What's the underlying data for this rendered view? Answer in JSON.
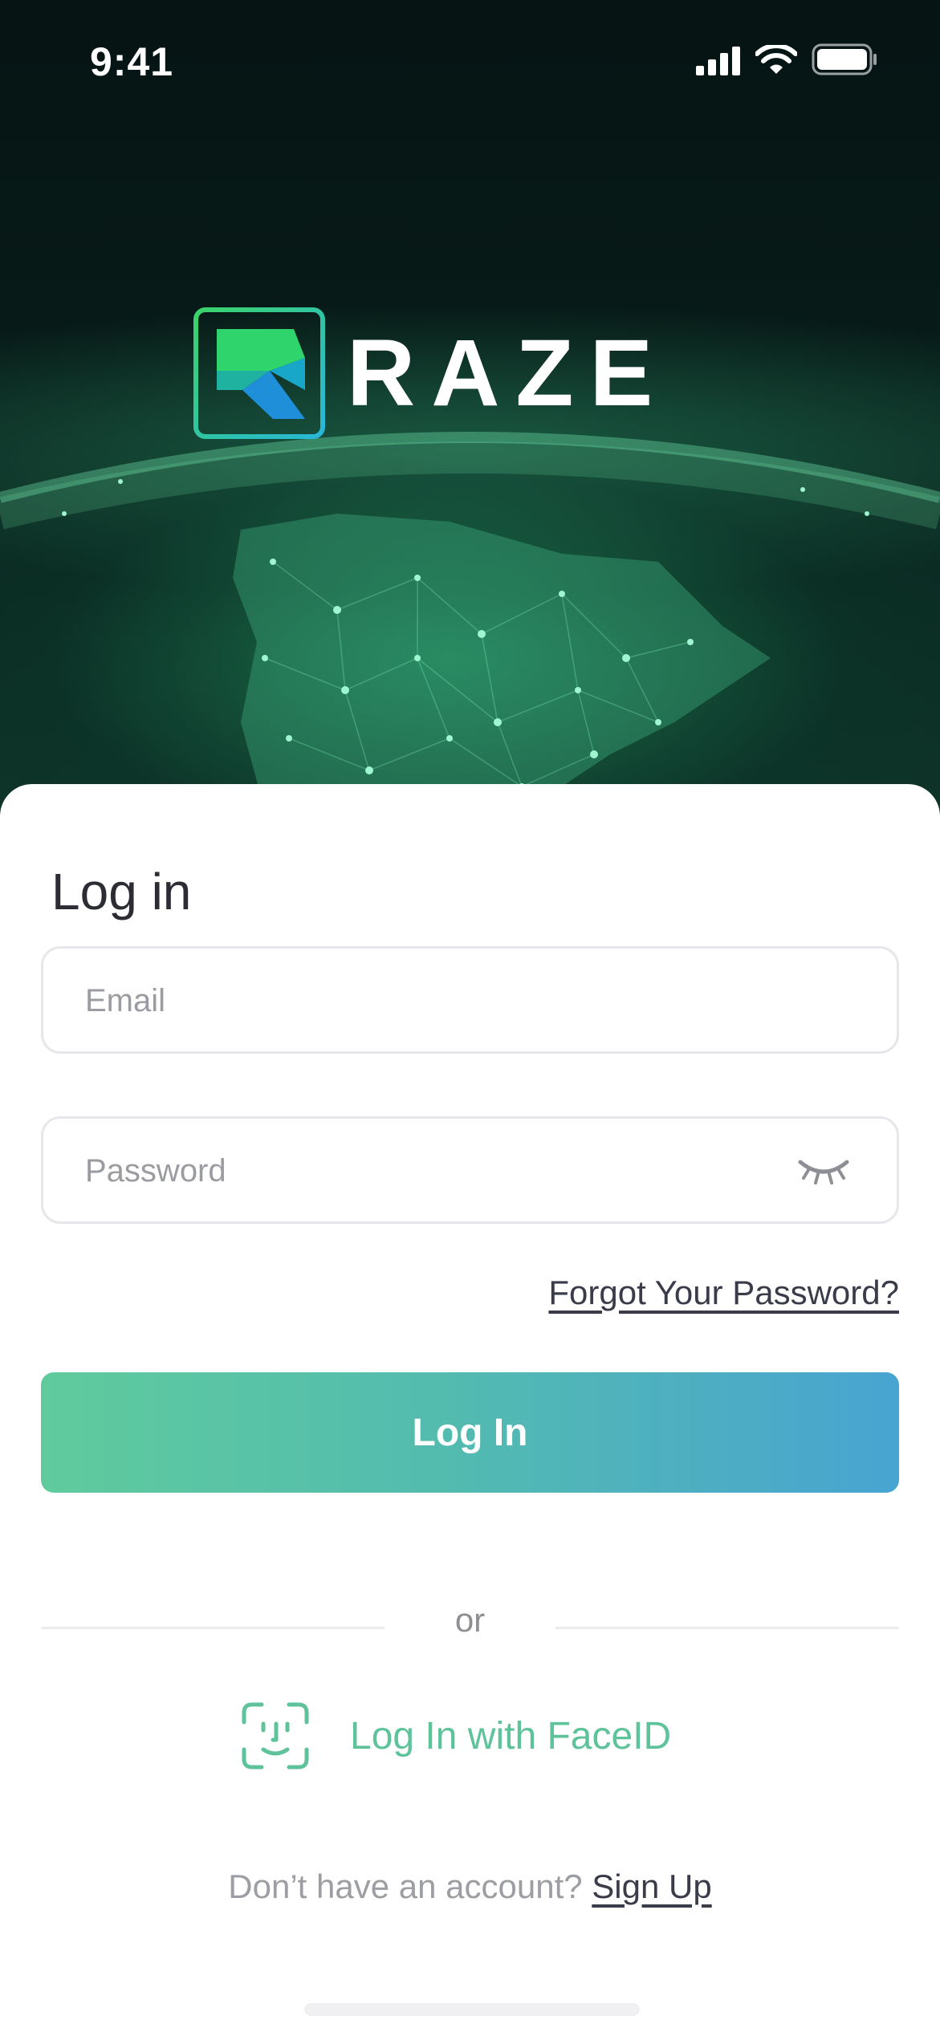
{
  "status_bar": {
    "time": "9:41"
  },
  "brand": {
    "name": "RAZE",
    "accent": "#5ec39a"
  },
  "login": {
    "title": "Log in",
    "email_placeholder": "Email",
    "password_placeholder": "Password",
    "forgot_label": "Forgot Your Password?",
    "submit_label": "Log In",
    "or_label": "or",
    "faceid_label": "Log In with FaceID",
    "signup_prompt": "Don’t have an account?",
    "signup_label": "Sign Up"
  },
  "colors": {
    "button_gradient_start": "#5fcb9d",
    "button_gradient_end": "#48a4d1",
    "faceid": "#5ec39a"
  },
  "icons": {
    "cellular": "cellular-signal-icon",
    "wifi": "wifi-icon",
    "battery": "battery-icon",
    "eye": "eye-closed-icon",
    "faceid": "faceid-icon"
  }
}
